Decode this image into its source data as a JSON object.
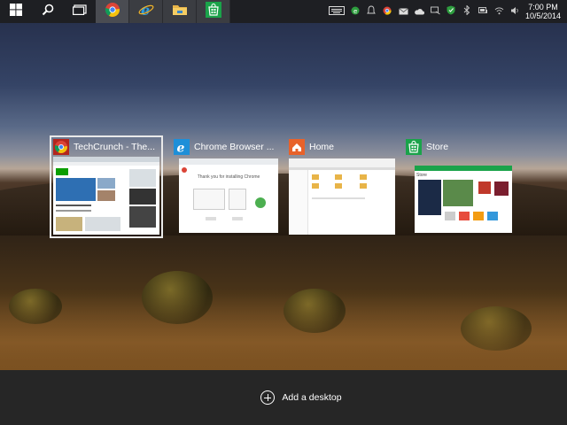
{
  "taskbar": {
    "pinned_apps": [
      "chrome-icon",
      "internet-explorer-icon",
      "file-explorer-icon",
      "store-icon"
    ]
  },
  "tray": {
    "time": "7:00 PM",
    "date": "10/5/2014"
  },
  "task_view": {
    "windows": [
      {
        "label": "TechCrunch - The...",
        "icon": "chrome-icon"
      },
      {
        "label": "Chrome Browser ...",
        "icon": "internet-explorer-icon"
      },
      {
        "label": "Home",
        "icon": "file-explorer-icon"
      },
      {
        "label": "Store",
        "icon": "store-icon"
      }
    ],
    "thumb_text": {
      "chrome_install": "Thank you for installing Chrome",
      "store_title": "Store"
    }
  },
  "bottom": {
    "add_desktop_label": "Add a desktop"
  },
  "colors": {
    "taskbar": "#1e1f23",
    "bottom_bar": "#262626",
    "store_green": "#1aa34a",
    "explorer_orange": "#e8622a",
    "ie_blue": "#1e8fd8"
  }
}
